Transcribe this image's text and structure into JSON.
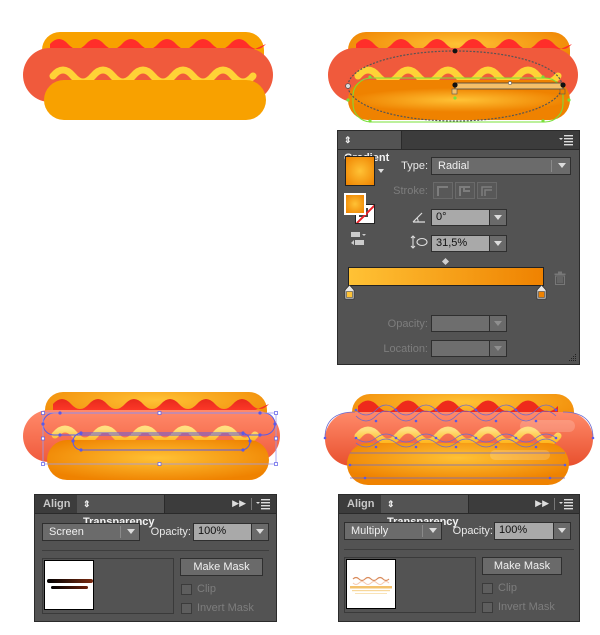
{
  "colors": {
    "bun": "#f8a100",
    "sausage": "#f05a3c",
    "ketchup": "#ff2e2a",
    "mustard": "#ffd236",
    "bun_gradient_light": "#ffc235",
    "bun_gradient_dark": "#ef8200",
    "selection_blue": "#5a5ae8",
    "selection_green": "#7ae03a",
    "panel_bg": "#535353"
  },
  "illustrations": [
    {
      "name": "hotdog-flat",
      "step": 1
    },
    {
      "name": "hotdog-gradient-edit",
      "step": 2
    },
    {
      "name": "hotdog-highlight-screen",
      "step": 3
    },
    {
      "name": "hotdog-multiply-shadows",
      "step": 4
    }
  ],
  "gradient_panel": {
    "title": "Gradient",
    "type_label": "Type:",
    "type_value": "Radial",
    "stroke_label": "Stroke:",
    "angle_value": "0°",
    "aspect_value": "31,5%",
    "opacity_label": "Opacity:",
    "opacity_value": "",
    "location_label": "Location:",
    "location_value": "",
    "stops": [
      {
        "position": 0,
        "color": "#ffc235"
      },
      {
        "position": 100,
        "color": "#ef8200"
      }
    ]
  },
  "transparency_panels": [
    {
      "tabs": [
        "Align",
        "Transparency"
      ],
      "active_tab": "Transparency",
      "blend_mode": "Screen",
      "opacity_label": "Opacity:",
      "opacity_value": "100%",
      "make_mask_label": "Make Mask",
      "clip_label": "Clip",
      "invert_mask_label": "Invert Mask"
    },
    {
      "tabs": [
        "Align",
        "Transparency"
      ],
      "active_tab": "Transparency",
      "blend_mode": "Multiply",
      "opacity_label": "Opacity:",
      "opacity_value": "100%",
      "make_mask_label": "Make Mask",
      "clip_label": "Clip",
      "invert_mask_label": "Invert Mask"
    }
  ]
}
